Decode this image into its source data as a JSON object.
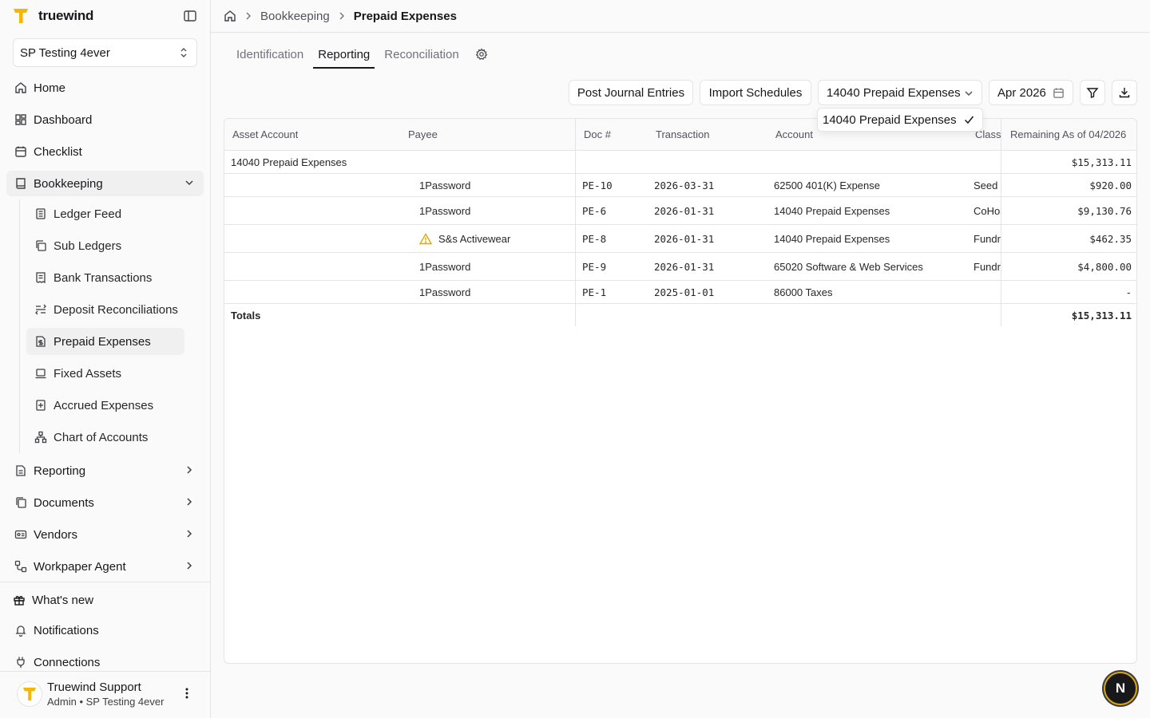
{
  "brand": {
    "name": "truewind",
    "accent": "#f5b800"
  },
  "org": {
    "selected": "SP Testing 4ever"
  },
  "sidebar": {
    "items": [
      {
        "label": "Home",
        "icon": "home-icon"
      },
      {
        "label": "Dashboard",
        "icon": "dashboard-icon"
      },
      {
        "label": "Checklist",
        "icon": "calendar-check-icon"
      },
      {
        "label": "Bookkeeping",
        "icon": "book-icon"
      }
    ],
    "bookkeeping_sub": [
      {
        "label": "Ledger Feed"
      },
      {
        "label": "Sub Ledgers"
      },
      {
        "label": "Bank Transactions"
      },
      {
        "label": "Deposit Reconciliations"
      },
      {
        "label": "Prepaid Expenses"
      },
      {
        "label": "Fixed Assets"
      },
      {
        "label": "Accrued Expenses"
      },
      {
        "label": "Chart of Accounts"
      }
    ],
    "sections": [
      {
        "label": "Reporting"
      },
      {
        "label": "Documents"
      },
      {
        "label": "Vendors"
      },
      {
        "label": "Workpaper Agent"
      }
    ],
    "footer": [
      {
        "label": "What's new"
      },
      {
        "label": "Notifications"
      },
      {
        "label": "Connections"
      }
    ]
  },
  "user": {
    "name": "Truewind Support",
    "role": "Admin • SP Testing 4ever"
  },
  "breadcrumb": {
    "section": "Bookkeeping",
    "current": "Prepaid Expenses"
  },
  "tabs": [
    {
      "label": "Identification"
    },
    {
      "label": "Reporting"
    },
    {
      "label": "Reconciliation"
    }
  ],
  "toolbar": {
    "post_label": "Post Journal Entries",
    "import_label": "Import Schedules",
    "account_selected": "14040 Prepaid Expenses",
    "period": "Apr 2026"
  },
  "account_dropdown": {
    "option": "14040 Prepaid Expenses"
  },
  "table": {
    "headers": {
      "asset_account": "Asset Account",
      "payee": "Payee",
      "doc": "Doc #",
      "transaction": "Transaction",
      "account": "Account",
      "class": "Class",
      "remaining": "Remaining As of 04/2026"
    },
    "group": {
      "asset_account": "14040 Prepaid Expenses",
      "remaining": "$15,313.11"
    },
    "rows": [
      {
        "payee": "1Password",
        "doc": "PE-10",
        "date": "2026-03-31",
        "account": "62500 401(K) Expense",
        "class": "Seed Round",
        "remaining": "$920.00",
        "warning": false
      },
      {
        "payee": "1Password",
        "doc": "PE-6",
        "date": "2026-01-31",
        "account": "14040 Prepaid Expenses",
        "class": "CoHost",
        "remaining": "$9,130.76",
        "warning": false
      },
      {
        "payee": "S&s Activewear",
        "doc": "PE-8",
        "date": "2026-01-31",
        "account": "14040 Prepaid Expenses",
        "class": "Fundraising",
        "remaining": "$462.35",
        "warning": true
      },
      {
        "payee": "1Password",
        "doc": "PE-9",
        "date": "2026-01-31",
        "account": "65020 Software & Web Services",
        "class": "Fundraising",
        "remaining": "$4,800.00",
        "warning": false
      },
      {
        "payee": "1Password",
        "doc": "PE-1",
        "date": "2025-01-01",
        "account": "86000 Taxes",
        "class": "",
        "remaining": "-",
        "warning": false
      }
    ],
    "totals": {
      "label": "Totals",
      "remaining": "$15,313.11"
    }
  },
  "assistant": {
    "initial": "N"
  }
}
